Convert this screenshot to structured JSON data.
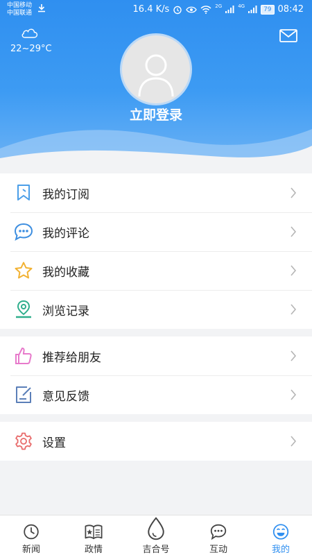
{
  "status_bar": {
    "carrier1": "中国移动",
    "carrier2": "中国联通",
    "net_speed": "16.4 K/s",
    "signal1": "2G",
    "signal2": "4G",
    "battery": "79",
    "time": "08:42"
  },
  "header": {
    "weather_icon": "cloud-icon",
    "temperature": "22~29°C",
    "login_label": "立即登录",
    "mail_icon": "mail-icon"
  },
  "menu_group1": [
    {
      "label": "我的订阅",
      "icon": "bookmark-icon",
      "color": "#4a9ee8"
    },
    {
      "label": "我的评论",
      "icon": "comment-icon",
      "color": "#3d8ee0"
    },
    {
      "label": "我的收藏",
      "icon": "star-icon",
      "color": "#f2b233"
    },
    {
      "label": "浏览记录",
      "icon": "location-icon",
      "color": "#2fae8c"
    }
  ],
  "menu_group2": [
    {
      "label": "推荐给朋友",
      "icon": "thumbs-up-icon",
      "color": "#e77acb"
    },
    {
      "label": "意见反馈",
      "icon": "feedback-icon",
      "color": "#5b7fb8"
    }
  ],
  "menu_group3": [
    {
      "label": "设置",
      "icon": "gear-icon",
      "color": "#e86a6a"
    }
  ],
  "tabs": [
    {
      "label": "新闻",
      "icon": "clock-icon"
    },
    {
      "label": "政情",
      "icon": "book-icon"
    },
    {
      "label": "吉合号",
      "icon": "drop-icon"
    },
    {
      "label": "互动",
      "icon": "chat-icon"
    },
    {
      "label": "我的",
      "icon": "smile-icon",
      "active": true
    }
  ],
  "colors": {
    "accent": "#2f8ff0",
    "background": "#f2f3f5"
  }
}
